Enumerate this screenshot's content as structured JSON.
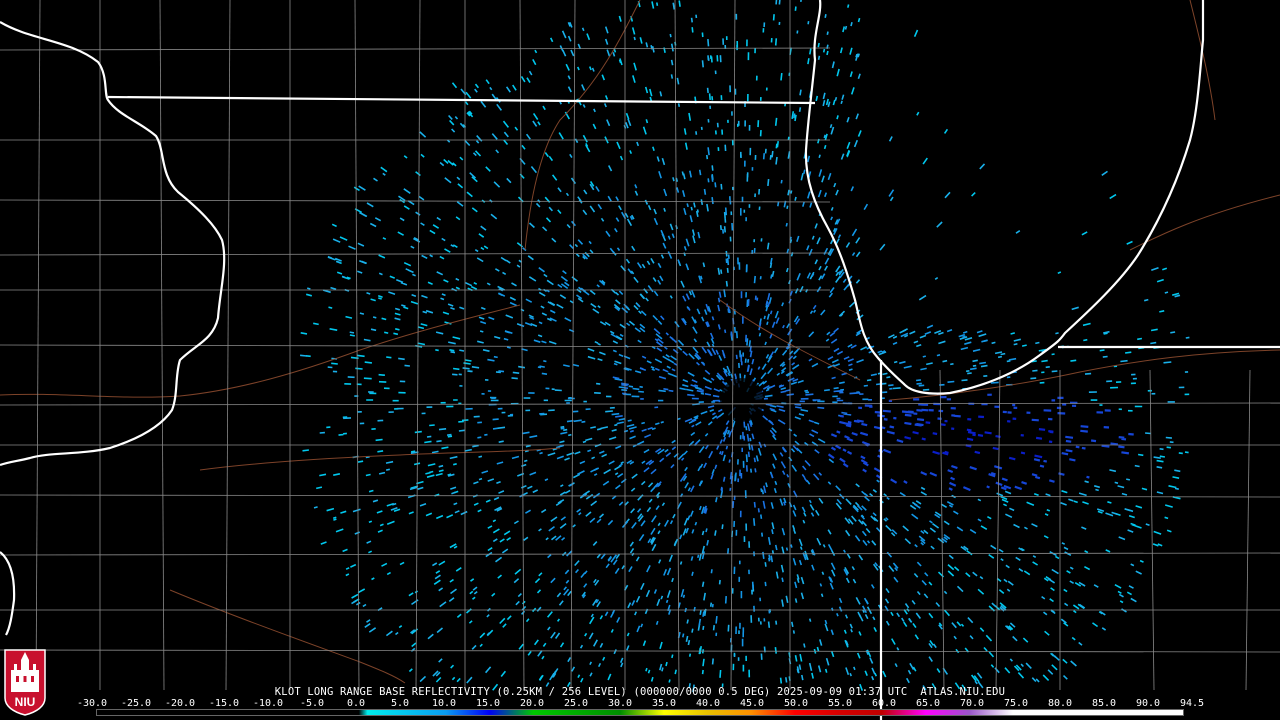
{
  "product_caption": "KLOT LONG RANGE BASE REFLECTIVITY (0.25KM / 256 LEVEL) (000000/0000 0.5 DEG) 2025-09-09 01:37 UTC  ATLAS.NIU.EDU",
  "colorbar": {
    "ticks": [
      "-30.0",
      "-25.0",
      "-20.0",
      "-15.0",
      "-10.0",
      "-5.0",
      "0.0",
      "5.0",
      "10.0",
      "15.0",
      "20.0",
      "25.0",
      "30.0",
      "35.0",
      "40.0",
      "45.0",
      "50.0",
      "55.0",
      "60.0",
      "65.0",
      "70.0",
      "75.0",
      "80.0",
      "85.0",
      "90.0",
      "94.5"
    ],
    "stops": [
      {
        "dbz": -30,
        "color": "#000000"
      },
      {
        "dbz": 0,
        "color": "#000000"
      },
      {
        "dbz": 1,
        "color": "#00ecec"
      },
      {
        "dbz": 10,
        "color": "#0a9bf0"
      },
      {
        "dbz": 15,
        "color": "#0000f6"
      },
      {
        "dbz": 20,
        "color": "#00c800"
      },
      {
        "dbz": 30,
        "color": "#008e00"
      },
      {
        "dbz": 35,
        "color": "#ffff00"
      },
      {
        "dbz": 40,
        "color": "#e7c000"
      },
      {
        "dbz": 45,
        "color": "#ff9000"
      },
      {
        "dbz": 50,
        "color": "#ff0000"
      },
      {
        "dbz": 55,
        "color": "#d60000"
      },
      {
        "dbz": 60,
        "color": "#c00000"
      },
      {
        "dbz": 65,
        "color": "#ff00ff"
      },
      {
        "dbz": 70,
        "color": "#9955c9"
      },
      {
        "dbz": 75,
        "color": "#ffffff"
      },
      {
        "dbz": 94.5,
        "color": "#ffffff"
      }
    ]
  },
  "logo": {
    "text": "NIU",
    "color": "#c8102e"
  },
  "map_colors": {
    "state_border": "#ffffff",
    "county_line": "#8a8a8a",
    "highway": "#8b4a2e",
    "background": "#000000"
  },
  "echo_palette": [
    "#00c8ee",
    "#19b0ea",
    "#1396e6",
    "#1a72e4",
    "#1646d8",
    "#0a1ec8"
  ]
}
